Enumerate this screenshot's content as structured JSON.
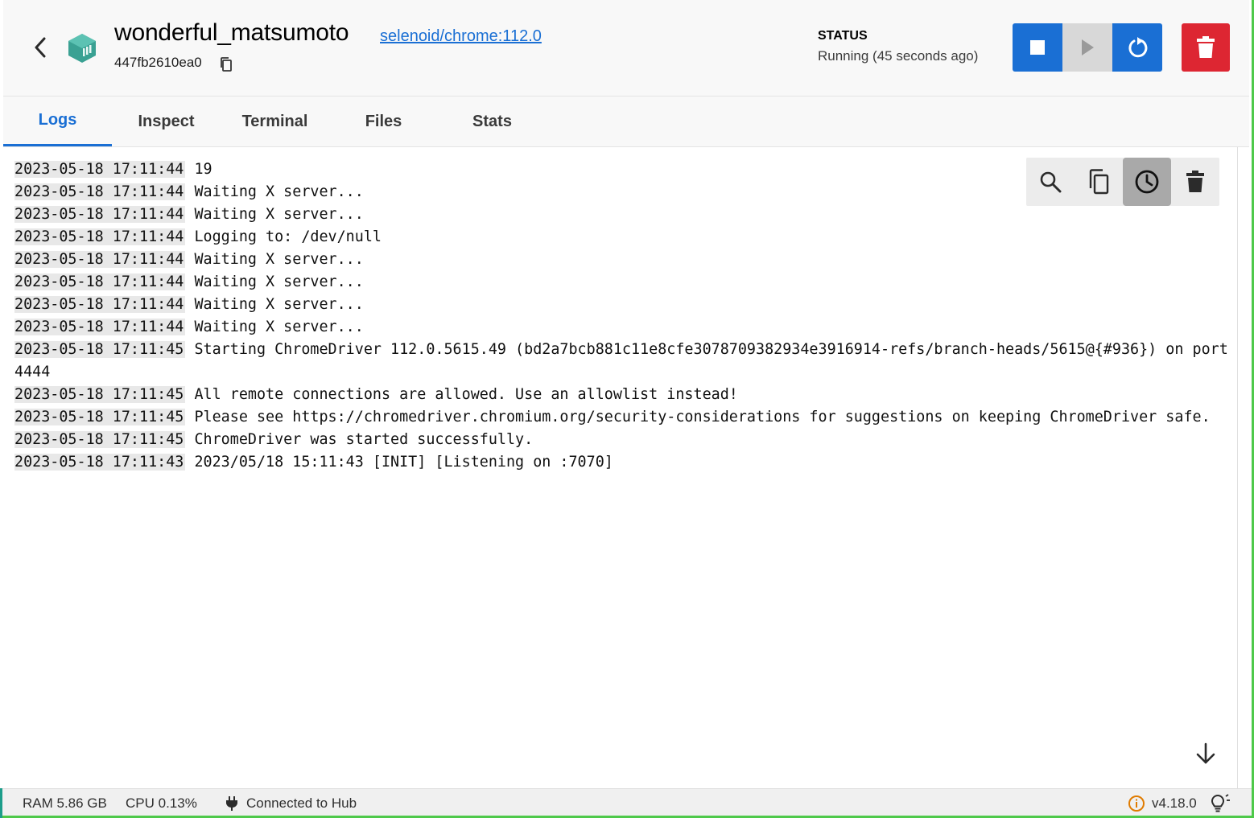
{
  "header": {
    "container_name": "wonderful_matsumoto",
    "image_link": "selenoid/chrome:112.0",
    "container_id": "447fb2610ea0",
    "status_label": "STATUS",
    "status_value": "Running (45 seconds ago)",
    "brand_color": "#1a6fd4",
    "delete_color": "#dd2632",
    "container_icon_color": "#3aa193"
  },
  "tabs": [
    {
      "label": "Logs",
      "active": true
    },
    {
      "label": "Inspect",
      "active": false
    },
    {
      "label": "Terminal",
      "active": false
    },
    {
      "label": "Files",
      "active": false
    },
    {
      "label": "Stats",
      "active": false
    }
  ],
  "logs": [
    {
      "ts": "2023-05-18 17:11:44",
      "msg": "19"
    },
    {
      "ts": "2023-05-18 17:11:44",
      "msg": "Waiting X server..."
    },
    {
      "ts": "2023-05-18 17:11:44",
      "msg": "Waiting X server..."
    },
    {
      "ts": "2023-05-18 17:11:44",
      "msg": "Logging to: /dev/null"
    },
    {
      "ts": "2023-05-18 17:11:44",
      "msg": "Waiting X server..."
    },
    {
      "ts": "2023-05-18 17:11:44",
      "msg": "Waiting X server..."
    },
    {
      "ts": "2023-05-18 17:11:44",
      "msg": "Waiting X server..."
    },
    {
      "ts": "2023-05-18 17:11:44",
      "msg": "Waiting X server..."
    },
    {
      "ts": "2023-05-18 17:11:45",
      "msg": "Starting ChromeDriver 112.0.5615.49 (bd2a7bcb881c11e8cfe3078709382934e3916914-refs/branch-heads/5615@{#936}) on port",
      "continuation": "4444"
    },
    {
      "ts": "2023-05-18 17:11:45",
      "msg": "All remote connections are allowed. Use an allowlist instead!"
    },
    {
      "ts": "2023-05-18 17:11:45",
      "msg": "Please see https://chromedriver.chromium.org/security-considerations for suggestions on keeping ChromeDriver safe."
    },
    {
      "ts": "2023-05-18 17:11:45",
      "msg": "ChromeDriver was started successfully."
    },
    {
      "ts": "2023-05-18 17:11:43",
      "msg": "2023/05/18 15:11:43 [INIT] [Listening on :7070]"
    }
  ],
  "log_toolbar": {
    "icons": [
      "search-icon",
      "copy-icon",
      "clock-icon",
      "trash-icon"
    ],
    "active": "clock-icon"
  },
  "footer": {
    "ram": "RAM 5.86 GB",
    "cpu": "CPU 0.13%",
    "hub": "Connected to Hub",
    "version": "v4.18.0",
    "info_color": "#e07b00"
  }
}
